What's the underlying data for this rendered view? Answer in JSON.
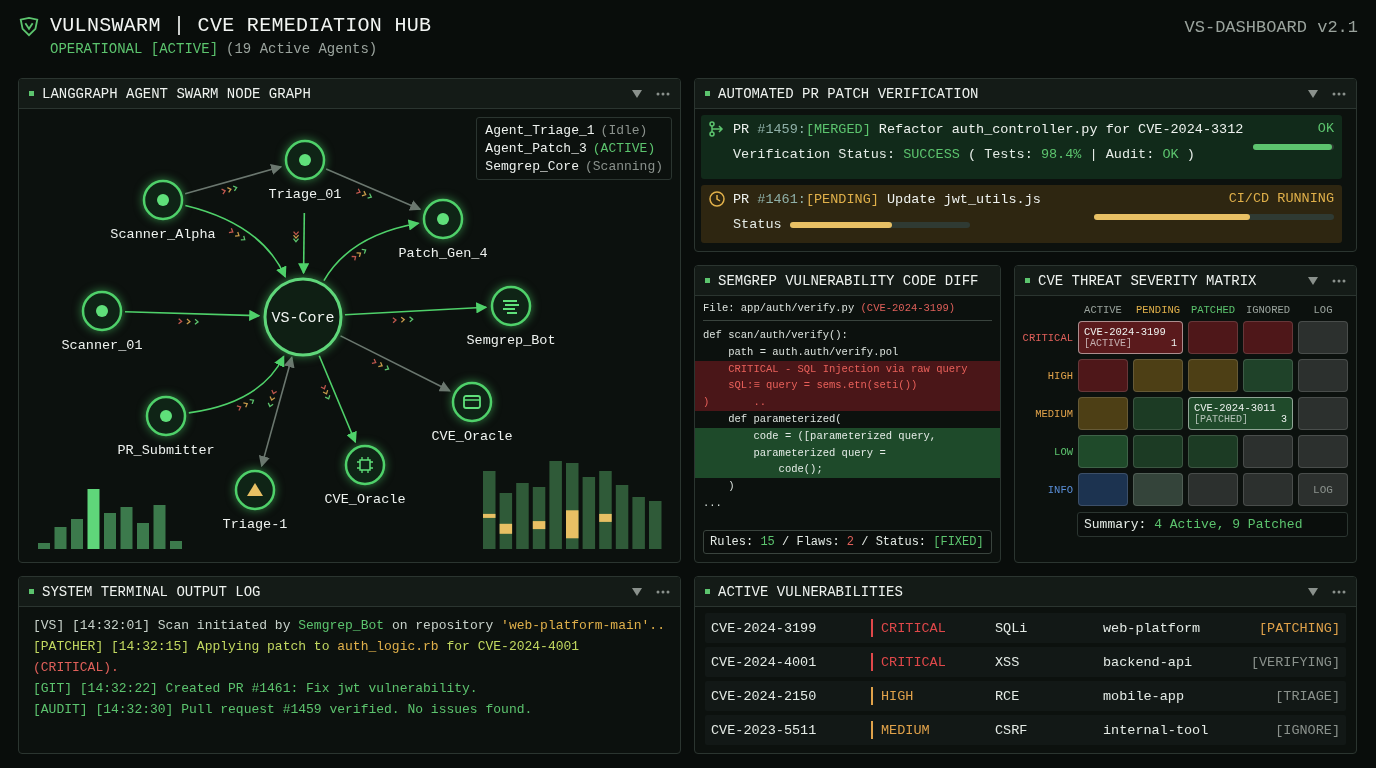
{
  "header": {
    "title": "VULNSWARM | CVE REMEDIATION HUB",
    "status": "OPERATIONAL [ACTIVE]",
    "agents": "(19 Active Agents)",
    "version": "VS-DASHBOARD v2.1"
  },
  "graph": {
    "title": "LANGGRAPH AGENT SWARM NODE GRAPH",
    "core": {
      "label": "VS-Core"
    },
    "nodes": [
      {
        "label": "Scanner_Alpha",
        "kind": "dot"
      },
      {
        "label": "Triage_01",
        "kind": "dot"
      },
      {
        "label": "Patch_Gen_4",
        "kind": "dot"
      },
      {
        "label": "Scanner_01",
        "kind": "dot"
      },
      {
        "label": "Semgrep_Bot",
        "kind": "bot"
      },
      {
        "label": "PR_Submitter",
        "kind": "dot"
      },
      {
        "label": "CVE_Oracle",
        "kind": "oracle"
      },
      {
        "label": "CVE_Oracle",
        "kind": "chip"
      },
      {
        "label": "Triage-1",
        "kind": "alert"
      }
    ],
    "legend": [
      {
        "name": "Agent_Triage_1",
        "status": "(Idle)",
        "active": false
      },
      {
        "name": "Agent_Patch_3",
        "status": "(ACTIVE)",
        "active": true
      },
      {
        "name": "Semgrep_Core",
        "status": "(Scanning)",
        "active": false
      }
    ]
  },
  "pr": {
    "title": "AUTOMATED PR PATCH VERIFICATION",
    "items": [
      {
        "kind": "merged",
        "prefix": "PR",
        "number": "#1459:",
        "tag": "[MERGED]",
        "title": "Refactor auth_controller.py for CVE-2024-3312",
        "result": "OK",
        "level": 0.97,
        "detail": [
          {
            "text": "Verification Status: ",
            "accent": false
          },
          {
            "text": "SUCCESS",
            "accent": true
          },
          {
            "text": " ( Tests: ",
            "accent": false
          },
          {
            "text": "98.4%",
            "accent": true
          },
          {
            "text": " | Audit: ",
            "accent": false
          },
          {
            "text": "OK",
            "accent": true
          },
          {
            "text": " )",
            "accent": false
          }
        ]
      },
      {
        "kind": "pending",
        "prefix": "PR",
        "number": "#1461:",
        "tag": "[PENDING]",
        "title": "Update jwt_utils.js",
        "result": "CI/CD RUNNING",
        "level": 0.65,
        "status_label": "Status",
        "status_bar": {
          "level": 0.57
        }
      }
    ]
  },
  "diff": {
    "title": "SEMGREP VULNERABILITY CODE DIFF",
    "file": "File: app/auth/verify.py",
    "cve": "(CVE-2024-3199)",
    "lines": [
      {
        "text": "def scan/auth/verify():",
        "kind": "context"
      },
      {
        "text": "    path = auth.auth/verify.pol",
        "kind": "context"
      },
      {
        "text": "    CRITICAL - SQL Injection via raw query",
        "kind": "removed"
      },
      {
        "text": "    sQL:≡ query = sems.etn(seti())",
        "kind": "removed"
      },
      {
        "text": ")       ..",
        "kind": "removed"
      },
      {
        "text": "    def parameterized(",
        "kind": "context"
      },
      {
        "text": "        code = ([parameterized query,",
        "kind": "added"
      },
      {
        "text": "        parameterized query =",
        "kind": "added"
      },
      {
        "text": "            code();",
        "kind": "added"
      },
      {
        "text": "    )",
        "kind": "context"
      },
      {
        "text": "...",
        "kind": "context"
      }
    ],
    "footer": [
      {
        "text": "Rules: ",
        "color": "#e4ebe6"
      },
      {
        "text": "15",
        "color": "#5cc46e"
      },
      {
        "text": " / Flaws: ",
        "color": "#e4ebe6"
      },
      {
        "text": "2",
        "color": "#e0605a"
      },
      {
        "text": " / Status: ",
        "color": "#e4ebe6"
      },
      {
        "text": "[FIXED]",
        "color": "#5cc46e"
      }
    ]
  },
  "matrix": {
    "title": "CVE THREAT SEVERITY MATRIX",
    "columns": [
      {
        "label": "ACTIVE",
        "color": "#9aa39d"
      },
      {
        "label": "PENDING",
        "color": "#e0b04a"
      },
      {
        "label": "PATCHED",
        "color": "#5cc46e"
      },
      {
        "label": "IGNORED",
        "color": "#9aa39d"
      },
      {
        "label": "LOG",
        "color": "#9aa39d"
      }
    ],
    "rows": [
      {
        "label": "CRITICAL",
        "color": "#e0605a",
        "cells": [
          {
            "color": "#5a1a1c",
            "id": "CVE-2024-3199",
            "tag": "[ACTIVE]",
            "count": "1"
          },
          {
            "color": "#4e1719"
          },
          {
            "color": "#4e1719"
          },
          {
            "color": "#2c302e"
          }
        ]
      },
      {
        "label": "HIGH",
        "color": "#e0a24a",
        "cells": [
          {
            "color": "#4e1719"
          },
          {
            "color": "#4d3f15"
          },
          {
            "color": "#4d3f15"
          },
          {
            "color": "#1f4229"
          },
          {
            "color": "#2c302e"
          }
        ]
      },
      {
        "label": "MEDIUM",
        "color": "#e0a24a",
        "cells": [
          {
            "color": "#4d3f15"
          },
          {
            "color": "#1c3b24"
          },
          {
            "color": "#1f4a2a",
            "id": "CVE-2024-3011",
            "tag": "[PATCHED]",
            "count": "3"
          },
          {
            "color": "#2c302e"
          }
        ]
      },
      {
        "label": "LOW",
        "color": "#5cc46e",
        "cells": [
          {
            "color": "#1f4a2a"
          },
          {
            "color": "#1c3b24"
          },
          {
            "color": "#1c3b24"
          },
          {
            "color": "#2c302e"
          },
          {
            "color": "#2c302e"
          }
        ]
      },
      {
        "label": "INFO",
        "color": "#5a8fd8",
        "cells": [
          {
            "color": "#1c3350"
          },
          {
            "color": "#34443a"
          },
          {
            "color": "#2c302e"
          },
          {
            "color": "#2c302e"
          },
          {
            "color": "#2c302e",
            "text": "LOG"
          }
        ]
      }
    ],
    "summary_label": "Summary:",
    "summary_value": "4 Active, 9 Patched"
  },
  "terminal": {
    "title": "SYSTEM TERMINAL OUTPUT LOG",
    "lines": [
      [
        {
          "text": "[VS] [14:32:01] Scan initiated by ",
          "color": "#c8d2cb"
        },
        {
          "text": "Semgrep_Bot",
          "color": "#5cc46e"
        },
        {
          "text": " on repository ",
          "color": "#c8d2cb"
        },
        {
          "text": "'web-platform-main'..",
          "color": "#e0b04a"
        }
      ],
      [
        {
          "text": "[PATCHER] [14:32:15] Applying patch to ",
          "color": "#c2d860"
        },
        {
          "text": "auth_logic.rb",
          "color": "#e0b04a"
        },
        {
          "text": " for CVE-2024-4001",
          "color": "#c2d860"
        }
      ],
      [
        {
          "text": "(CRITICAL).",
          "color": "#e0605a"
        }
      ],
      [
        {
          "text": "[GIT] [14:32:22] Created PR #1461: Fix jwt vulnerability.",
          "color": "#5cc46e"
        }
      ],
      [
        {
          "text": "[AUDIT] [14:32:30] Pull request #1459 verified. No issues found.",
          "color": "#5cc46e"
        }
      ]
    ]
  },
  "vulns": {
    "title": "ACTIVE VULNERABILITIES",
    "rows": [
      {
        "id": "CVE-2024-3199",
        "severity": {
          "label": "CRITICAL",
          "color": "#e0484a"
        },
        "type": "SQLi",
        "repo": "web-platform",
        "status": {
          "label": "[PATCHING]",
          "color": "#e0a24a"
        }
      },
      {
        "id": "CVE-2024-4001",
        "severity": {
          "label": "CRITICAL",
          "color": "#e0484a"
        },
        "type": "XSS",
        "repo": "backend-api",
        "status": {
          "label": "[VERIFYING]",
          "color": "#8a918c"
        }
      },
      {
        "id": "CVE-2024-2150",
        "severity": {
          "label": "HIGH",
          "color": "#e0a24a"
        },
        "type": "RCE",
        "repo": "mobile-app",
        "status": {
          "label": "[TRIAGE]",
          "color": "#8a918c"
        }
      },
      {
        "id": "CVE-2023-5511",
        "severity": {
          "label": "MEDIUM",
          "color": "#e0a24a"
        },
        "type": "CSRF",
        "repo": "internal-tool",
        "status": {
          "label": "[IGNORE]",
          "color": "#8a918c"
        }
      }
    ]
  }
}
